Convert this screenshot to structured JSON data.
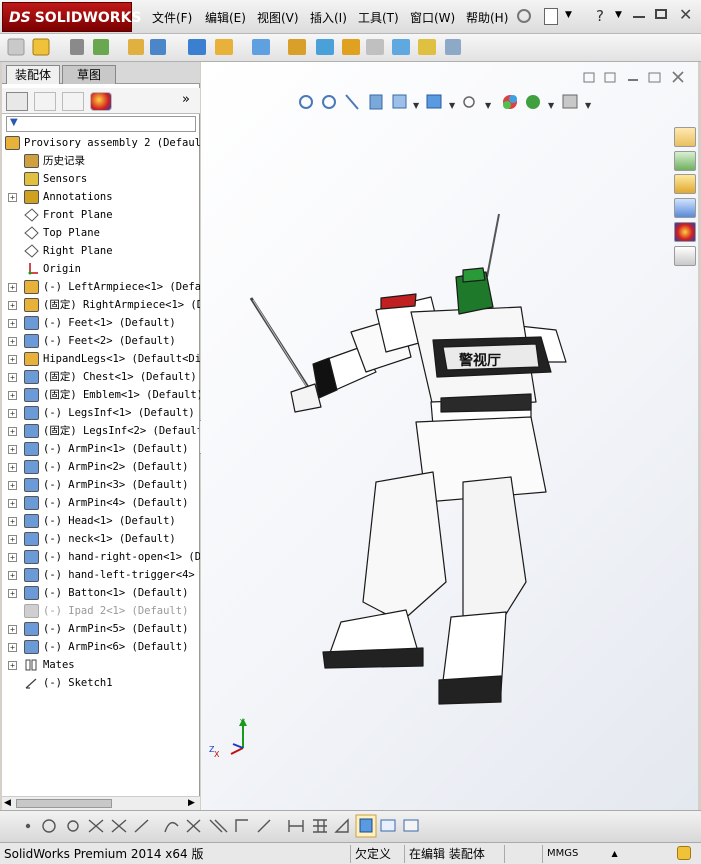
{
  "app": {
    "logo_brand": "SOLIDWORKS",
    "logo_prefix": "DS"
  },
  "menu": [
    "文件(F)",
    "编辑(E)",
    "视图(V)",
    "插入(I)",
    "工具(T)",
    "窗口(W)",
    "帮助(H)"
  ],
  "tabs": [
    "装配体",
    "草图"
  ],
  "tree": [
    {
      "label": "Provisory assembly 2  (Defaul",
      "icon": "assembly-icon",
      "expand": false,
      "level": 0
    },
    {
      "label": "历史记录",
      "icon": "history-icon",
      "expand": false,
      "level": 1
    },
    {
      "label": "Sensors",
      "icon": "sensors-icon",
      "expand": false,
      "level": 1
    },
    {
      "label": "Annotations",
      "icon": "annotations-icon",
      "expand": true,
      "level": 1
    },
    {
      "label": "Front Plane",
      "icon": "plane-icon",
      "expand": false,
      "level": 1
    },
    {
      "label": "Top Plane",
      "icon": "plane-icon",
      "expand": false,
      "level": 1
    },
    {
      "label": "Right Plane",
      "icon": "plane-icon",
      "expand": false,
      "level": 1
    },
    {
      "label": "Origin",
      "icon": "origin-icon",
      "expand": false,
      "level": 1
    },
    {
      "label": "(-) LeftArmpiece<1> (Defau",
      "icon": "subassembly-icon",
      "expand": true,
      "level": 1
    },
    {
      "label": "(固定) RightArmpiece<1> (D",
      "icon": "subassembly-icon",
      "expand": true,
      "level": 1
    },
    {
      "label": "(-) Feet<1> (Default)",
      "icon": "part-icon",
      "expand": true,
      "level": 1
    },
    {
      "label": "(-) Feet<2> (Default)",
      "icon": "part-icon",
      "expand": true,
      "level": 1
    },
    {
      "label": "HipandLegs<1> (Default<Dis",
      "icon": "subassembly-icon",
      "expand": true,
      "level": 1
    },
    {
      "label": "(固定) Chest<1> (Default)",
      "icon": "part-icon",
      "expand": true,
      "level": 1
    },
    {
      "label": "(固定) Emblem<1> (Default)",
      "icon": "part-icon",
      "expand": true,
      "level": 1
    },
    {
      "label": "(-) LegsInf<1> (Default)",
      "icon": "part-icon",
      "expand": true,
      "level": 1
    },
    {
      "label": "(固定) LegsInf<2> (Default",
      "icon": "part-icon",
      "expand": true,
      "level": 1
    },
    {
      "label": "(-) ArmPin<1> (Default)",
      "icon": "part-icon",
      "expand": true,
      "level": 1
    },
    {
      "label": "(-) ArmPin<2> (Default)",
      "icon": "part-icon",
      "expand": true,
      "level": 1
    },
    {
      "label": "(-) ArmPin<3> (Default)",
      "icon": "part-icon",
      "expand": true,
      "level": 1
    },
    {
      "label": "(-) ArmPin<4> (Default)",
      "icon": "part-icon",
      "expand": true,
      "level": 1
    },
    {
      "label": "(-) Head<1> (Default)",
      "icon": "part-icon",
      "expand": true,
      "level": 1
    },
    {
      "label": "(-) neck<1> (Default)",
      "icon": "part-icon",
      "expand": true,
      "level": 1
    },
    {
      "label": "(-) hand-right-open<1> (De",
      "icon": "part-icon",
      "expand": true,
      "level": 1
    },
    {
      "label": "(-) hand-left-trigger<4> (",
      "icon": "part-icon",
      "expand": true,
      "level": 1
    },
    {
      "label": "(-) Batton<1> (Default)",
      "icon": "part-icon",
      "expand": true,
      "level": 1
    },
    {
      "label": "(-) Ipad 2<1> (Default)",
      "icon": "part-icon",
      "expand": false,
      "level": 1,
      "suppressed": true
    },
    {
      "label": "(-) ArmPin<5> (Default)",
      "icon": "part-icon",
      "expand": true,
      "level": 1
    },
    {
      "label": "(-) ArmPin<6> (Default)",
      "icon": "part-icon",
      "expand": true,
      "level": 1
    },
    {
      "label": "Mates",
      "icon": "mates-icon",
      "expand": true,
      "level": 1
    },
    {
      "label": "(-) Sketch1",
      "icon": "sketch-icon",
      "expand": false,
      "level": 1
    }
  ],
  "viewport": {
    "axis_x": "X",
    "axis_y": "Y",
    "axis_z": "Z",
    "emblem_text": "警视厅"
  },
  "status": {
    "product": "SolidWorks Premium 2014 x64 版",
    "defined": "欠定义",
    "editing": "在编辑 装配体",
    "units": "MMGS",
    "units_arrow": "▲"
  },
  "colors": {
    "accent_red": "#b01010",
    "head_green": "#1e7a2a",
    "viewport_bg": "#f3f5f9"
  }
}
